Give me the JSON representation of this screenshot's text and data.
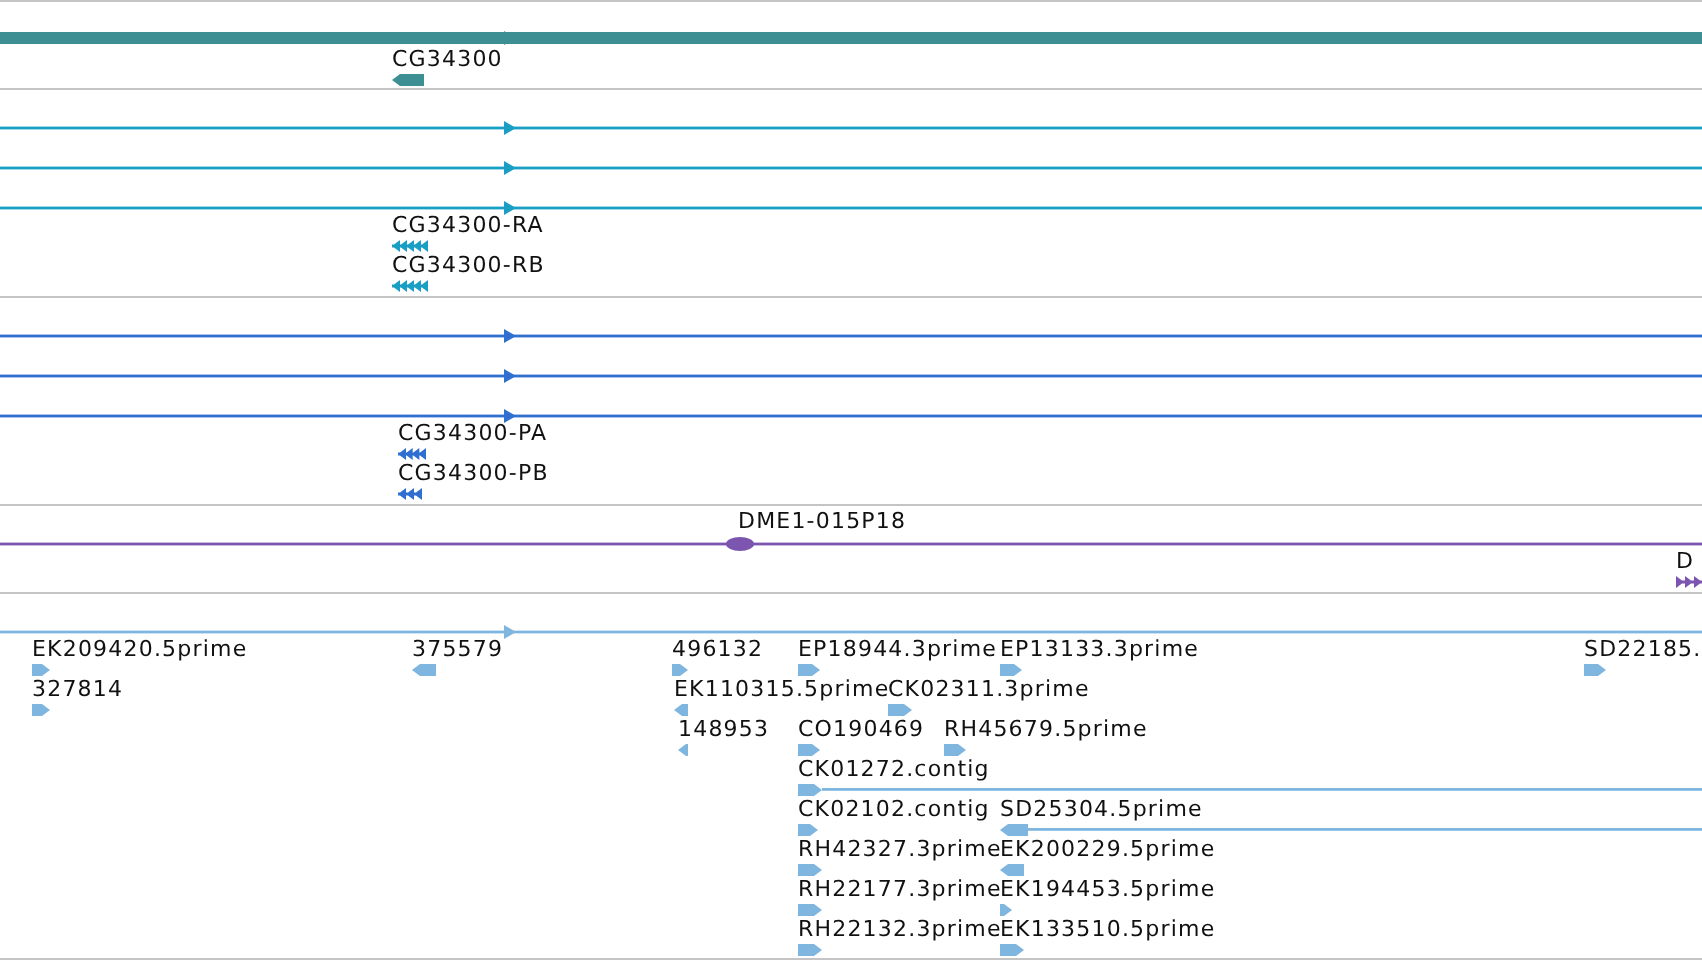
{
  "tracks": [
    {
      "kind": "gene",
      "color": "#3d8f93",
      "spans": [
        {
          "kind": "arrow",
          "reverse": false
        }
      ],
      "features": [
        {
          "label": "CG34300",
          "reverse": true,
          "kind": "block"
        }
      ]
    },
    {
      "kind": "transcript",
      "color": "#1a9fc4",
      "spans": [
        {
          "kind": "arrow",
          "reverse": false
        },
        {
          "kind": "arrow",
          "reverse": false
        },
        {
          "kind": "arrow",
          "reverse": false
        }
      ],
      "features": [
        {
          "label": "CG34300-RA",
          "reverse": true,
          "kind": "exons"
        },
        {
          "label": "CG34300-RB",
          "reverse": true,
          "kind": "exons"
        }
      ]
    },
    {
      "kind": "protein",
      "color": "#2e6fd0",
      "spans": [
        {
          "kind": "arrow",
          "reverse": false
        },
        {
          "kind": "arrow",
          "reverse": false
        },
        {
          "kind": "arrow",
          "reverse": false
        }
      ],
      "features": [
        {
          "label": "CG34300-PA",
          "reverse": true,
          "kind": "exons"
        },
        {
          "label": "CG34300-PB",
          "reverse": true,
          "kind": "exons"
        }
      ]
    },
    {
      "kind": "clone",
      "color": "#7b55b0",
      "spans": [
        {
          "kind": "oval",
          "label": "DME1-015P18"
        }
      ],
      "features": [
        {
          "label": "D",
          "reverse": false,
          "kind": "exons"
        }
      ]
    },
    {
      "kind": "est",
      "color": "#7fb6e0",
      "spans": [
        {
          "kind": "arrow",
          "reverse": false
        }
      ],
      "features": [
        {
          "label": "EK209420.5prime",
          "reverse": false,
          "kind": "block",
          "continues": false
        },
        {
          "label": "327814",
          "reverse": false,
          "kind": "block",
          "continues": false
        },
        {
          "label": "375579",
          "reverse": true,
          "kind": "block",
          "continues": false
        },
        {
          "label": "496132",
          "reverse": false,
          "kind": "block",
          "continues": false
        },
        {
          "label": "EK110315.5prime",
          "reverse": true,
          "kind": "block",
          "continues": false
        },
        {
          "label": "148953",
          "reverse": true,
          "kind": "block",
          "continues": false
        },
        {
          "label": "EP18944.3prime",
          "reverse": false,
          "kind": "block",
          "continues": false
        },
        {
          "label": "EP13133.3prime",
          "reverse": false,
          "kind": "block",
          "continues": false
        },
        {
          "label": "SD22185.",
          "reverse": false,
          "kind": "block",
          "continues": false
        },
        {
          "label": "CK02311.3prime",
          "reverse": false,
          "kind": "block",
          "continues": false
        },
        {
          "label": "CO190469",
          "reverse": false,
          "kind": "block",
          "continues": false
        },
        {
          "label": "RH45679.5prime",
          "reverse": false,
          "kind": "block",
          "continues": false
        },
        {
          "label": "CK01272.contig",
          "reverse": false,
          "kind": "block",
          "continues": true
        },
        {
          "label": "CK02102.contig",
          "reverse": false,
          "kind": "block",
          "continues": false
        },
        {
          "label": "SD25304.5prime",
          "reverse": true,
          "kind": "block",
          "continues": true
        },
        {
          "label": "RH42327.3prime",
          "reverse": false,
          "kind": "block",
          "continues": false
        },
        {
          "label": "EK200229.5prime",
          "reverse": true,
          "kind": "block",
          "continues": false
        },
        {
          "label": "RH22177.3prime",
          "reverse": false,
          "kind": "block",
          "continues": false
        },
        {
          "label": "EK194453.5prime",
          "reverse": false,
          "kind": "block",
          "continues": false
        },
        {
          "label": "RH22132.3prime",
          "reverse": false,
          "kind": "block",
          "continues": false
        },
        {
          "label": "EK133510.5prime",
          "reverse": false,
          "kind": "block",
          "continues": false
        }
      ]
    }
  ]
}
